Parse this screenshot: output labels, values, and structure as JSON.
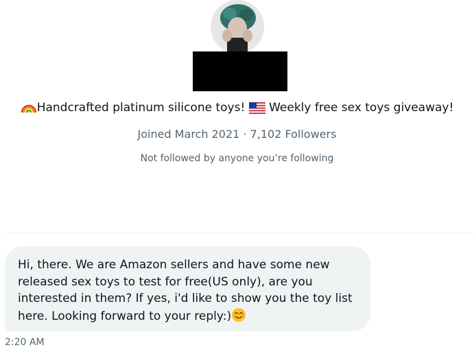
{
  "profile": {
    "avatar_icon": "profile-photo",
    "bio_prefix_icon": "rainbow-emoji",
    "bio_part1": "Handcrafted platinum silicone toys!",
    "bio_flag_icon": "us-flag-emoji",
    "bio_part2": "Weekly free sex toys giveaway!",
    "joined": "Joined March 2021",
    "separator": "·",
    "followers": "7,102 Followers",
    "followed_by": "Not followed by anyone you’re following"
  },
  "message": {
    "lines": [
      "Hi, there. We are Amazon sellers and have some new",
      "released sex toys to test for free(US only), are you",
      "interested in them? If yes, i'd like to show you the toy list",
      "here. Looking forward to your reply:)"
    ],
    "end_icon": "smiling-face-emoji",
    "time": "2:20 AM"
  },
  "colors": {
    "text": "#0f1419",
    "secondary": "#536471",
    "bubble": "#eff3f4"
  }
}
